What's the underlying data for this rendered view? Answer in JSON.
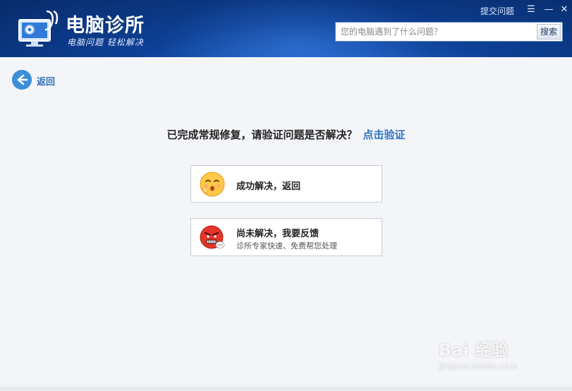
{
  "header": {
    "app_title": "电脑诊所",
    "slogan": "电脑问题 轻松解决",
    "report_link": "提交问题",
    "menu_icon": "menu-icon",
    "minimize_icon": "minimize-icon",
    "close_icon": "close-icon"
  },
  "search": {
    "placeholder": "您的电脑遇到了什么问题？",
    "value": "",
    "button_label": "搜索"
  },
  "back": {
    "icon": "back-arrow-icon",
    "label": "返回"
  },
  "prompt": {
    "text": "已完成常规修复，请验证问题是否解决？",
    "verify_link": "点击验证"
  },
  "options": [
    {
      "icon": "happy-face-icon",
      "title": "成功解决，返回"
    },
    {
      "icon": "angry-face-icon",
      "title": "尚未解决，我要反馈",
      "subtitle": "诊所专家快速、免费帮您处理"
    }
  ],
  "watermark": {
    "main": "Bai 经验",
    "sub": "jingyan.baidu.com"
  },
  "colors": {
    "header_bg": "#0d3f93",
    "accent_blue": "#2f73c3",
    "back_icon": "#3c8fd8"
  }
}
